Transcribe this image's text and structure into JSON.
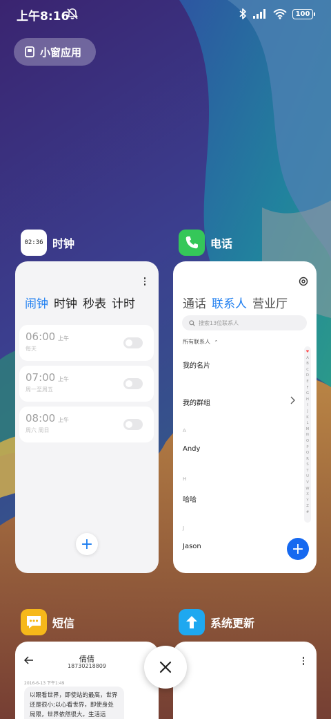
{
  "status_bar": {
    "time": "上午8:16",
    "battery": "100",
    "icons": [
      "do-not-disturb-icon",
      "bluetooth-icon",
      "signal-icon",
      "wifi-icon",
      "battery-icon"
    ]
  },
  "small_window_chip": {
    "label": "小窗应用",
    "icon": "small-window-icon"
  },
  "apps": {
    "clock": {
      "title": "时钟",
      "icon_text": "02:36",
      "tabs": [
        "闹钟",
        "时钟",
        "秒表",
        "计时"
      ],
      "active_tab": "闹钟",
      "alarms": [
        {
          "time": "06:00",
          "ampm": "上午",
          "repeat": "每天",
          "enabled": false
        },
        {
          "time": "07:00",
          "ampm": "上午",
          "repeat": "周一至周五",
          "enabled": false
        },
        {
          "time": "08:00",
          "ampm": "上午",
          "repeat": "周六 周日",
          "enabled": false
        }
      ],
      "add_label": "+"
    },
    "phone": {
      "title": "电话",
      "tabs": [
        "通话",
        "联系人",
        "营业厅"
      ],
      "active_tab": "联系人",
      "search_placeholder": "搜索13位联系人",
      "filter_label": "所有联系人",
      "rows": {
        "my_card": "我的名片",
        "my_groups": "我的群组",
        "section_a": "A",
        "andy": "Andy",
        "section_h": "H",
        "haha": "哈哈",
        "section_j": "J",
        "jason": "Jason"
      },
      "index_letters": [
        "♥",
        "A",
        "B",
        "C",
        "D",
        "E",
        "F",
        "G",
        "H",
        "I",
        "J",
        "K",
        "L",
        "M",
        "N",
        "O",
        "P",
        "Q",
        "R",
        "S",
        "T",
        "U",
        "V",
        "W",
        "X",
        "Y",
        "Z",
        "#"
      ],
      "add_label": "+"
    },
    "sms": {
      "title": "短信",
      "contact_name": "倩倩",
      "contact_number": "18730218809",
      "date": "2016-6-13 下午1:49",
      "message": "以眼看世界，即使站的最高，世界还是很小;以心看世界，即使身处局限，世界依然很大。生活远"
    },
    "update": {
      "title": "系统更新"
    }
  },
  "colors": {
    "accent": "#1e7ef0",
    "phone_green": "#35c759",
    "sms_yellow": "#f6b81a",
    "update_blue": "#1ea8f0",
    "fab_blue": "#1669f0"
  }
}
